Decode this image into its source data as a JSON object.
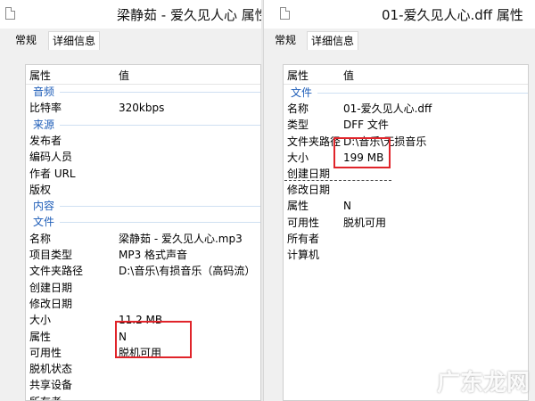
{
  "left_window": {
    "title": "梁静茹 - 爱久见人心 属性",
    "tabs": [
      "常规",
      "详细信息"
    ],
    "header": {
      "property": "属性",
      "value": "值"
    },
    "rows": [
      {
        "type": "section",
        "label": "音频"
      },
      {
        "type": "item",
        "key": "比特率",
        "value": "320kbps"
      },
      {
        "type": "section",
        "label": "来源"
      },
      {
        "type": "item",
        "key": "发布者",
        "value": ""
      },
      {
        "type": "item",
        "key": "编码人员",
        "value": ""
      },
      {
        "type": "item",
        "key": "作者 URL",
        "value": ""
      },
      {
        "type": "item",
        "key": "版权",
        "value": ""
      },
      {
        "type": "section",
        "label": "内容"
      },
      {
        "type": "section",
        "label": "文件"
      },
      {
        "type": "item",
        "key": "名称",
        "value": "梁静茹 - 爱久见人心.mp3"
      },
      {
        "type": "item",
        "key": "项目类型",
        "value": "MP3 格式声音"
      },
      {
        "type": "item",
        "key": "文件夹路径",
        "value": "D:\\音乐\\有损音乐（高码流）"
      },
      {
        "type": "item",
        "key": "创建日期",
        "value": ""
      },
      {
        "type": "item",
        "key": "修改日期",
        "value": ""
      },
      {
        "type": "item",
        "key": "大小",
        "value": "11.2 MB"
      },
      {
        "type": "item",
        "key": "属性",
        "value": "N"
      },
      {
        "type": "item",
        "key": "可用性",
        "value": "脱机可用"
      },
      {
        "type": "item",
        "key": "脱机状态",
        "value": ""
      },
      {
        "type": "item",
        "key": "共享设备",
        "value": ""
      },
      {
        "type": "item",
        "key": "所有者",
        "value": ""
      }
    ]
  },
  "right_window": {
    "title": "01-爱久见人心.dff 属性",
    "tabs": [
      "常规",
      "详细信息"
    ],
    "header": {
      "property": "属性",
      "value": "值"
    },
    "rows": [
      {
        "type": "section",
        "label": "文件"
      },
      {
        "type": "item",
        "key": "名称",
        "value": "01-爱久见人心.dff"
      },
      {
        "type": "item",
        "key": "类型",
        "value": "DFF 文件"
      },
      {
        "type": "item",
        "key": "文件夹路径",
        "value": "D:\\音乐\\无损音乐"
      },
      {
        "type": "item",
        "key": "大小",
        "value": "199 MB"
      },
      {
        "type": "item",
        "key": "创建日期",
        "value": ""
      },
      {
        "type": "item",
        "key": "修改日期",
        "value": ""
      },
      {
        "type": "item",
        "key": "属性",
        "value": "N"
      },
      {
        "type": "item",
        "key": "可用性",
        "value": "脱机可用"
      },
      {
        "type": "item",
        "key": "所有者",
        "value": ""
      },
      {
        "type": "item",
        "key": "计算机",
        "value": ""
      }
    ]
  },
  "watermark": "广东龙网",
  "colors": {
    "section": "#1e5db8",
    "highlight": "#e0242a"
  }
}
